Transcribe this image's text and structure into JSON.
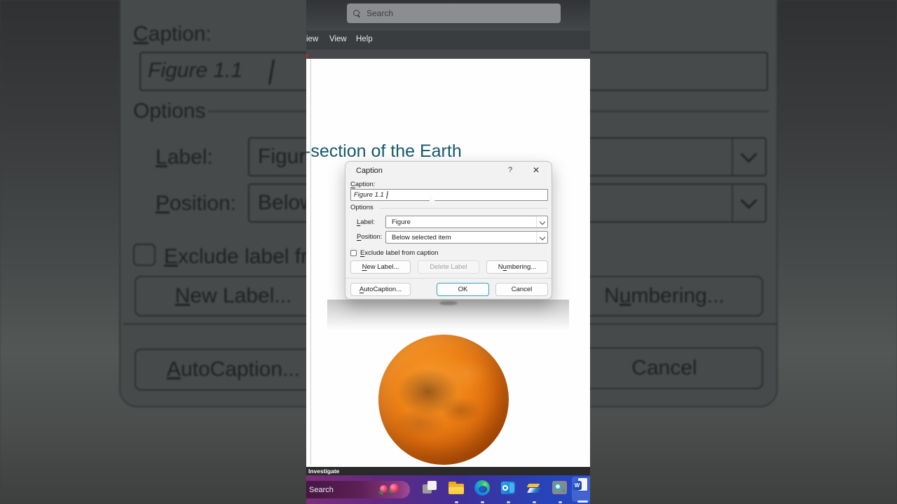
{
  "word": {
    "search_placeholder": "Search",
    "menu_items": [
      {
        "label": "iew"
      },
      {
        "label": "View"
      },
      {
        "label": "Help"
      }
    ]
  },
  "document": {
    "heading_fragment": "-section of the Earth",
    "figure_name": "mars-planet-image"
  },
  "caption_dialog": {
    "title": "Caption",
    "help_button": "?",
    "close_button": "✕",
    "caption_field": {
      "u": "C",
      "rest": "aption:",
      "value": "Figure 1.1"
    },
    "options_group": "Options",
    "label_row": {
      "u": "L",
      "rest": "abel:",
      "value": "Figure"
    },
    "position_row": {
      "u": "P",
      "rest": "osition:",
      "value": "Below selected item"
    },
    "exclude_checkbox": {
      "u": "E",
      "rest": "xclude label from caption",
      "checked": false
    },
    "buttons": {
      "new_label": {
        "u": "N",
        "rest": "ew Label..."
      },
      "delete_label": {
        "label": "Delete Label",
        "disabled": true
      },
      "numbering": {
        "pre": "N",
        "u": "u",
        "rest": "mbering..."
      },
      "autocaption": {
        "u": "A",
        "rest": "utoCaption..."
      },
      "ok": "OK",
      "cancel": "Cancel"
    }
  },
  "video_overlay": {
    "caption_text": "Investigate"
  },
  "taskbar": {
    "search_label": "Search",
    "word_icon_letter": "W",
    "icons": [
      "task-view-icon",
      "file-explorer-icon",
      "edge-icon",
      "outlook-icon",
      "yellow-app-icon",
      "magnifier-icon",
      "word-icon"
    ]
  },
  "colors": {
    "accent_default_button": "#36a2c0",
    "heading_teal": "#17586e",
    "mars_orange": "#ee8216",
    "taskbar_purple": "#7b2e78",
    "taskbar_blue": "#2449c6"
  }
}
